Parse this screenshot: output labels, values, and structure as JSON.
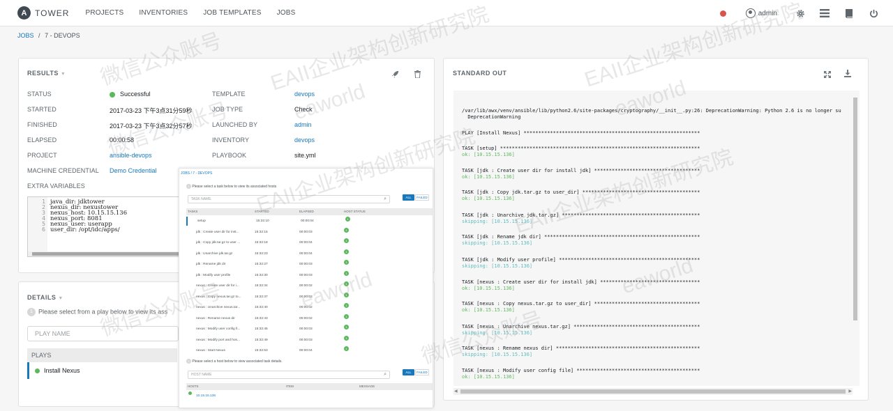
{
  "nav": {
    "logo_letter": "A",
    "logo_text": "TOWER",
    "items": [
      "PROJECTS",
      "INVENTORIES",
      "JOB TEMPLATES",
      "JOBS"
    ],
    "user": "admin",
    "icons": [
      "gear-icon",
      "list-icon",
      "book-icon",
      "power-icon"
    ]
  },
  "breadcrumb": {
    "root": "JOBS",
    "sep": "/",
    "current": "7 - DEVOPS"
  },
  "results": {
    "title": "RESULTS",
    "left": [
      {
        "label": "STATUS",
        "value": "Successful"
      },
      {
        "label": "STARTED",
        "value": "2017-03-23 下午3点31分59秒"
      },
      {
        "label": "FINISHED",
        "value": "2017-03-23 下午3点32分57秒"
      },
      {
        "label": "ELAPSED",
        "value": "00:00:58"
      },
      {
        "label": "PROJECT",
        "value": "ansible-devops"
      },
      {
        "label": "MACHINE CREDENTIAL",
        "value": "Demo Credential"
      }
    ],
    "right": [
      {
        "label": "TEMPLATE",
        "value": "devops"
      },
      {
        "label": "JOB TYPE",
        "value": "Check"
      },
      {
        "label": "LAUNCHED BY",
        "value": "admin"
      },
      {
        "label": "INVENTORY",
        "value": "devops"
      },
      {
        "label": "PLAYBOOK",
        "value": "site.yml"
      }
    ],
    "extra_label": "EXTRA VARIABLES",
    "extra_lines": [
      "java_dir: jdktower",
      "nexus_dir: nexustower",
      "nexus_host: 10.15.15.136",
      "nexus_port: 8081",
      "nexus_user: userapp",
      "user_dir: /opt/idc/apps/"
    ]
  },
  "details": {
    "title": "DETAILS",
    "hint_num": "1",
    "hint": "Please select from a play below to view its ass",
    "search_placeholder": "PLAY NAME",
    "plays_head": "PLAYS",
    "plays": [
      "Install Nexus"
    ]
  },
  "overlay": {
    "breadcrumb": "JOBS / 7 - DEVOPS",
    "task_hint": "Please select a task below to view its associated hosts",
    "task_placeholder": "TASK NAME",
    "btn_all": "ALL",
    "btn_failed": "FAILED",
    "cols": [
      "TASKS",
      "STARTED",
      "ELAPSED",
      "HOST STATUS"
    ],
    "tasks": [
      {
        "name": "setup",
        "started": "15:32:10",
        "elapsed": "00:00:04"
      },
      {
        "name": "jdk : Create user dir for inst...",
        "started": "15:32:15",
        "elapsed": "00:00:03"
      },
      {
        "name": "jdk : Copy jdk.tar.gz to user ...",
        "started": "15:32:18",
        "elapsed": "00:00:04"
      },
      {
        "name": "jdk : Unarchive jdk.tar.gz",
        "started": "15:32:23",
        "elapsed": "00:00:04"
      },
      {
        "name": "jdk : Rename jdk dir",
        "started": "15:32:27",
        "elapsed": "00:00:03"
      },
      {
        "name": "jdk : Modify user profile",
        "started": "15:32:30",
        "elapsed": "00:00:03"
      },
      {
        "name": "nexus : Create user dir for i...",
        "started": "15:32:34",
        "elapsed": "00:00:02"
      },
      {
        "name": "nexus : Copy nexus.tar.gz to...",
        "started": "15:32:37",
        "elapsed": "00:00:03"
      },
      {
        "name": "nexus : Unarchive nexus.tar...",
        "started": "15:32:40",
        "elapsed": "00:00:02"
      },
      {
        "name": "nexus : Rename nexus dir",
        "started": "15:32:43",
        "elapsed": "00:00:02"
      },
      {
        "name": "nexus : Modify user config fi...",
        "started": "15:32:45",
        "elapsed": "00:00:03"
      },
      {
        "name": "nexus : Modify port and hos...",
        "started": "15:32:49",
        "elapsed": "00:00:03"
      },
      {
        "name": "nexus : Start Nexus",
        "started": "15:32:53",
        "elapsed": "00:00:04"
      }
    ],
    "badge": "1",
    "host_hint": "Please select a host below to view associated task details.",
    "host_placeholder": "HOST NAME",
    "host_cols": [
      "HOSTS",
      "ITEM",
      "MESSAGE"
    ],
    "hosts": [
      "10.15.15.136"
    ]
  },
  "stdout": {
    "title": "STANDARD OUT",
    "lines": [
      {
        "t": "/var/lib/awx/venv/ansible/lib/python2.6/site-packages/cryptography/__init__.py:26: DeprecationWarning: Python 2.6 is no longer su",
        "c": ""
      },
      {
        "t": "  DeprecationWarning",
        "c": ""
      },
      {
        "t": "PLAY [Install Nexus] ************************************************************",
        "c": ""
      },
      {
        "t": "TASK [setup] ********************************************************************",
        "c": ""
      },
      {
        "t": "ok: [10.15.15.136]",
        "c": "ok"
      },
      {
        "t": "TASK [jdk : Create user dir for install jdk] ************************************",
        "c": ""
      },
      {
        "t": "ok: [10.15.15.136]",
        "c": "ok"
      },
      {
        "t": "TASK [jdk : Copy jdk.tar.gz to user_dir] ****************************************",
        "c": ""
      },
      {
        "t": "ok: [10.15.15.136]",
        "c": "ok"
      },
      {
        "t": "TASK [jdk : Unarchive jdk.tar.gz] ***********************************************",
        "c": ""
      },
      {
        "t": "skipping: [10.15.15.136]",
        "c": "skip"
      },
      {
        "t": "TASK [jdk : Rename jdk dir] *****************************************************",
        "c": ""
      },
      {
        "t": "skipping: [10.15.15.136]",
        "c": "skip"
      },
      {
        "t": "TASK [jdk : Modify user profile] ************************************************",
        "c": ""
      },
      {
        "t": "skipping: [10.15.15.136]",
        "c": "skip"
      },
      {
        "t": "TASK [nexus : Create user dir for install jdk] **********************************",
        "c": ""
      },
      {
        "t": "ok: [10.15.15.136]",
        "c": "ok"
      },
      {
        "t": "TASK [nexus : Copy nexus.tar.gz to user_dir] ************************************",
        "c": ""
      },
      {
        "t": "ok: [10.15.15.136]",
        "c": "ok"
      },
      {
        "t": "TASK [nexus : Unarchive nexus.tar.gz] *******************************************",
        "c": ""
      },
      {
        "t": "skipping: [10.15.15.136]",
        "c": "skip"
      },
      {
        "t": "TASK [nexus : Rename nexus dir] *************************************************",
        "c": ""
      },
      {
        "t": "skipping: [10.15.15.136]",
        "c": "skip"
      },
      {
        "t": "TASK [nexus : Modify user config file] ******************************************",
        "c": ""
      },
      {
        "t": "ok: [10.15.15.136]",
        "c": "ok"
      }
    ]
  },
  "watermarks": [
    "EAII企业架构创新研究院",
    "微信公众账号",
    "eaworld"
  ],
  "colors": {
    "accent": "#1778be",
    "success": "#5cb85c",
    "danger": "#d9534f",
    "skipping": "#5bbdbf"
  }
}
